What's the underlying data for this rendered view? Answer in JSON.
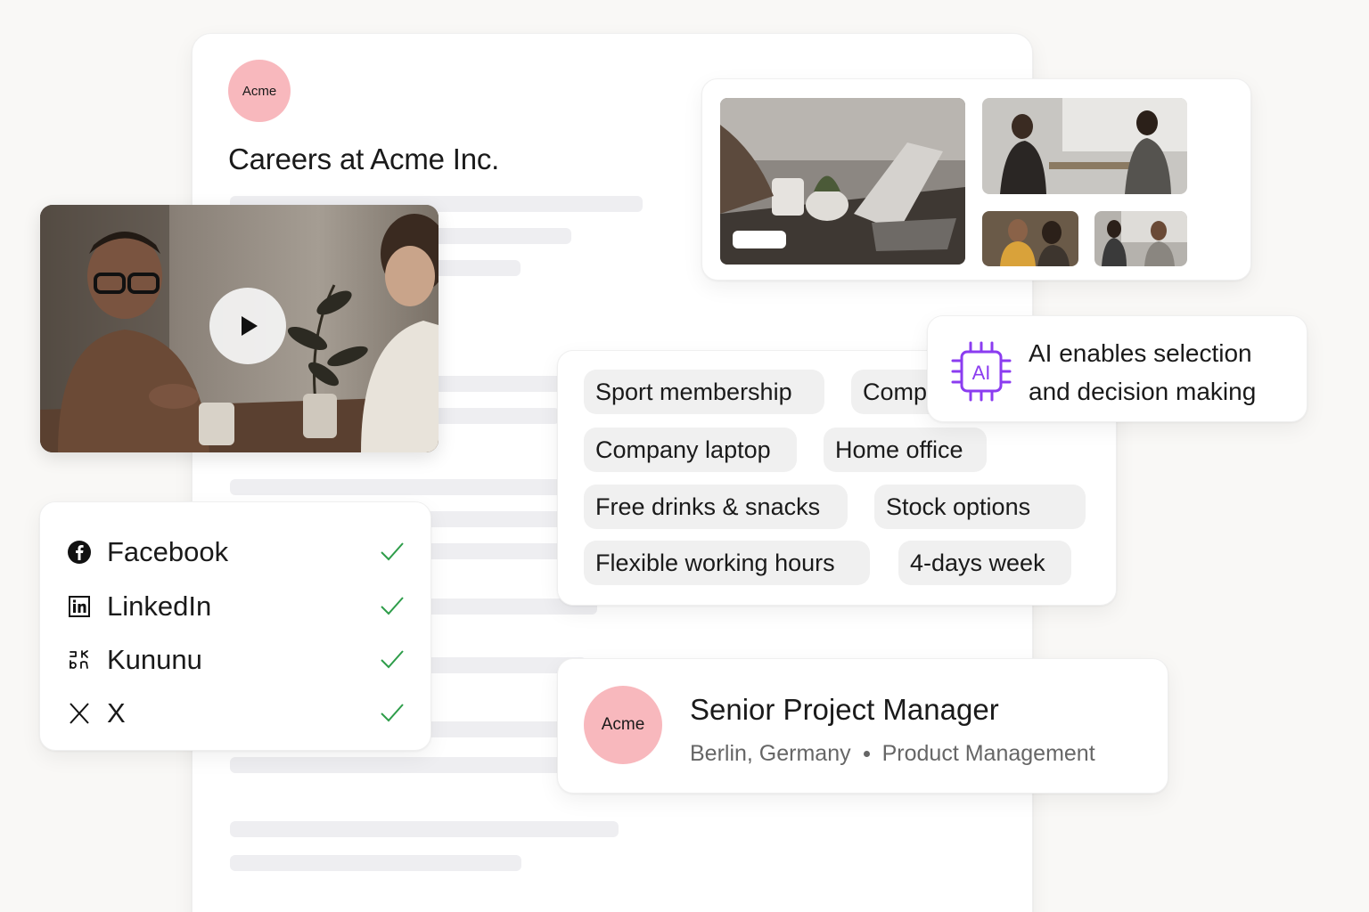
{
  "page": {
    "logo_text": "Acme",
    "title": "Careers at Acme Inc."
  },
  "video": {
    "play_icon": "play-icon"
  },
  "benefits": {
    "chips": [
      "Sport membership",
      "Company car",
      "Company laptop",
      "Home office",
      "Free drinks & snacks",
      "Stock options",
      "Flexible working hours",
      "4-days week"
    ]
  },
  "ai_feature": {
    "icon": "ai-chip-icon",
    "line1": "AI enables selection",
    "line2": "and decision making",
    "accent_color": "#8b3cf0"
  },
  "social": {
    "items": [
      {
        "label": "Facebook",
        "icon": "facebook-icon",
        "checked": true
      },
      {
        "label": "LinkedIn",
        "icon": "linkedin-icon",
        "checked": true
      },
      {
        "label": "Kununu",
        "icon": "kununu-icon",
        "checked": true
      },
      {
        "label": "X",
        "icon": "x-icon",
        "checked": true
      }
    ],
    "check_color": "#2e9d4a"
  },
  "job": {
    "logo_text": "Acme",
    "title": "Senior Project Manager",
    "location": "Berlin, Germany",
    "department": "Product Management"
  },
  "colors": {
    "avatar_bg": "#f8b8bd",
    "background": "#f9f8f6"
  }
}
